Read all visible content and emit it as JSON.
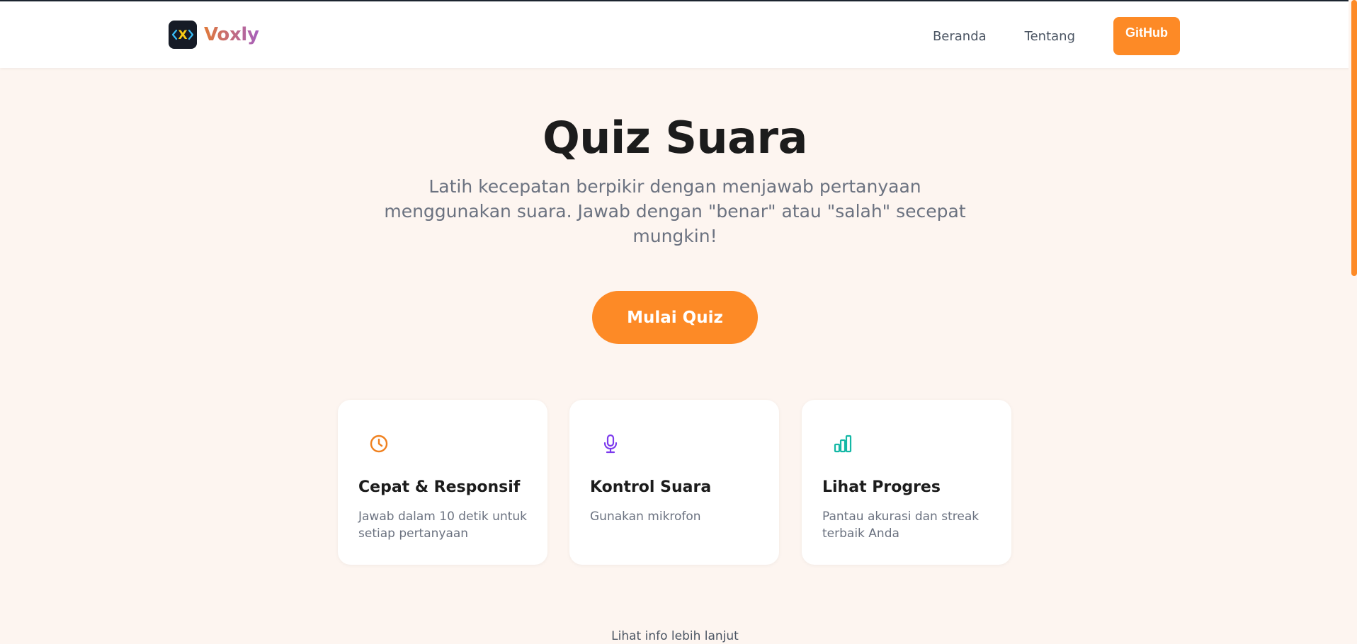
{
  "brand": {
    "logo_mark": "X",
    "name": "Voxly"
  },
  "nav": {
    "home": "Beranda",
    "about": "Tentang",
    "github": "GitHub"
  },
  "hero": {
    "title": "Quiz Suara",
    "subtitle": "Latih kecepatan berpikir dengan menjawab pertanyaan menggunakan suara. Jawab dengan \"benar\" atau \"salah\" secepat mungkin!",
    "start_button": "Mulai Quiz"
  },
  "features": [
    {
      "icon": "clock-icon",
      "title": "Cepat & Responsif",
      "description": "Jawab dalam 10 detik untuk setiap pertanyaan",
      "color": "#f0811f"
    },
    {
      "icon": "microphone-icon",
      "title": "Kontrol Suara",
      "description": "Gunakan mikrofon",
      "color": "#7c3aed"
    },
    {
      "icon": "bar-chart-icon",
      "title": "Lihat Progres",
      "description": "Pantau akurasi dan streak terbaik Anda",
      "color": "#14b8a6"
    }
  ],
  "more_info": "Lihat info lebih lanjut",
  "colors": {
    "accent": "#fd8a26",
    "background": "#fdf5f0",
    "dark": "#161b26"
  }
}
